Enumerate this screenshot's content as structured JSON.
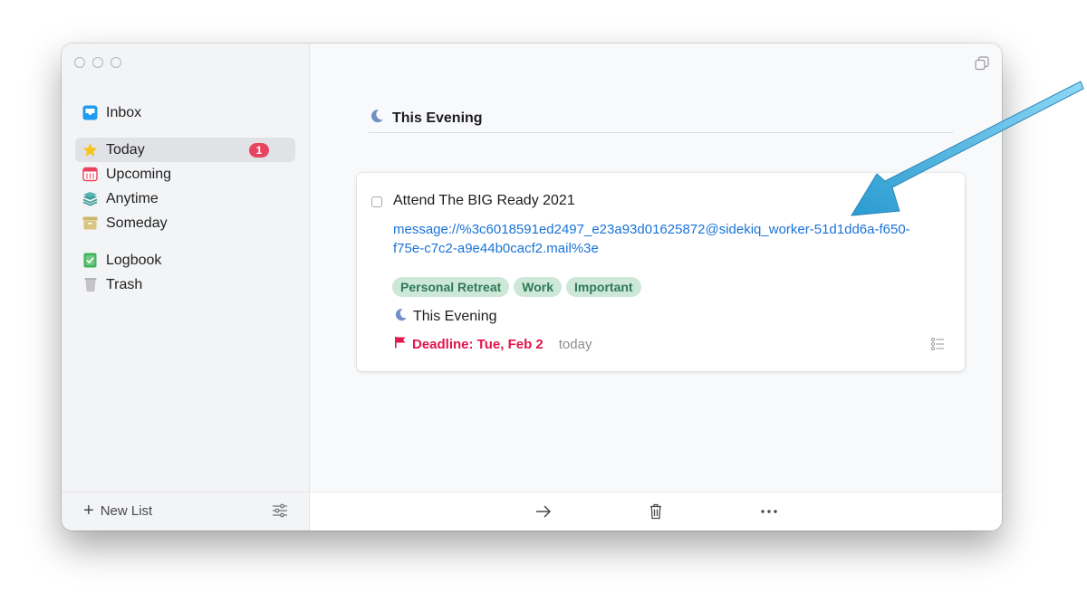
{
  "window": {
    "traffic_lights": [
      "close",
      "minimize",
      "zoom"
    ]
  },
  "sidebar": {
    "items": [
      {
        "label": "Inbox",
        "icon": "inbox-icon",
        "color": "#1f9cef"
      },
      {
        "label": "Today",
        "icon": "star-icon",
        "color": "#f6c51c",
        "badge": "1",
        "active": true
      },
      {
        "label": "Upcoming",
        "icon": "calendar-icon",
        "color": "#e8435f"
      },
      {
        "label": "Anytime",
        "icon": "layers-icon",
        "color": "#3a9c97"
      },
      {
        "label": "Someday",
        "icon": "archive-box-icon",
        "color": "#cdb56b"
      },
      {
        "label": "Logbook",
        "icon": "logbook-icon",
        "color": "#3fb55a"
      },
      {
        "label": "Trash",
        "icon": "trash-icon",
        "color": "#a9a9ad"
      }
    ],
    "footer": {
      "new_list_label": "New List",
      "filter_icon": "sliders-icon"
    }
  },
  "main": {
    "heading": "This Evening",
    "task": {
      "title": "Attend The BIG Ready 2021",
      "completed": false,
      "notes_link": "message://%3c6018591ed2497_e23a93d01625872@sidekiq_worker-51d1dd6a-f650-f75e-c7c2-a9e44b0cacf2.mail%3e",
      "tags": [
        "Personal Retreat",
        "Work",
        "Important"
      ],
      "when": "This Evening",
      "deadline": "Deadline: Tue, Feb 2",
      "deadline_relative": "today"
    },
    "toolbar": {
      "move_icon": "arrow-right-icon",
      "delete_icon": "trash-icon",
      "more_icon": "more-icon"
    }
  },
  "colors": {
    "accent_link": "#1a73d6",
    "badge": "#e8435f",
    "deadline": "#e3134c",
    "tag_bg": "#cde7d8",
    "tag_text": "#2f7a55",
    "annotation_arrow": "#3ba9d8"
  }
}
